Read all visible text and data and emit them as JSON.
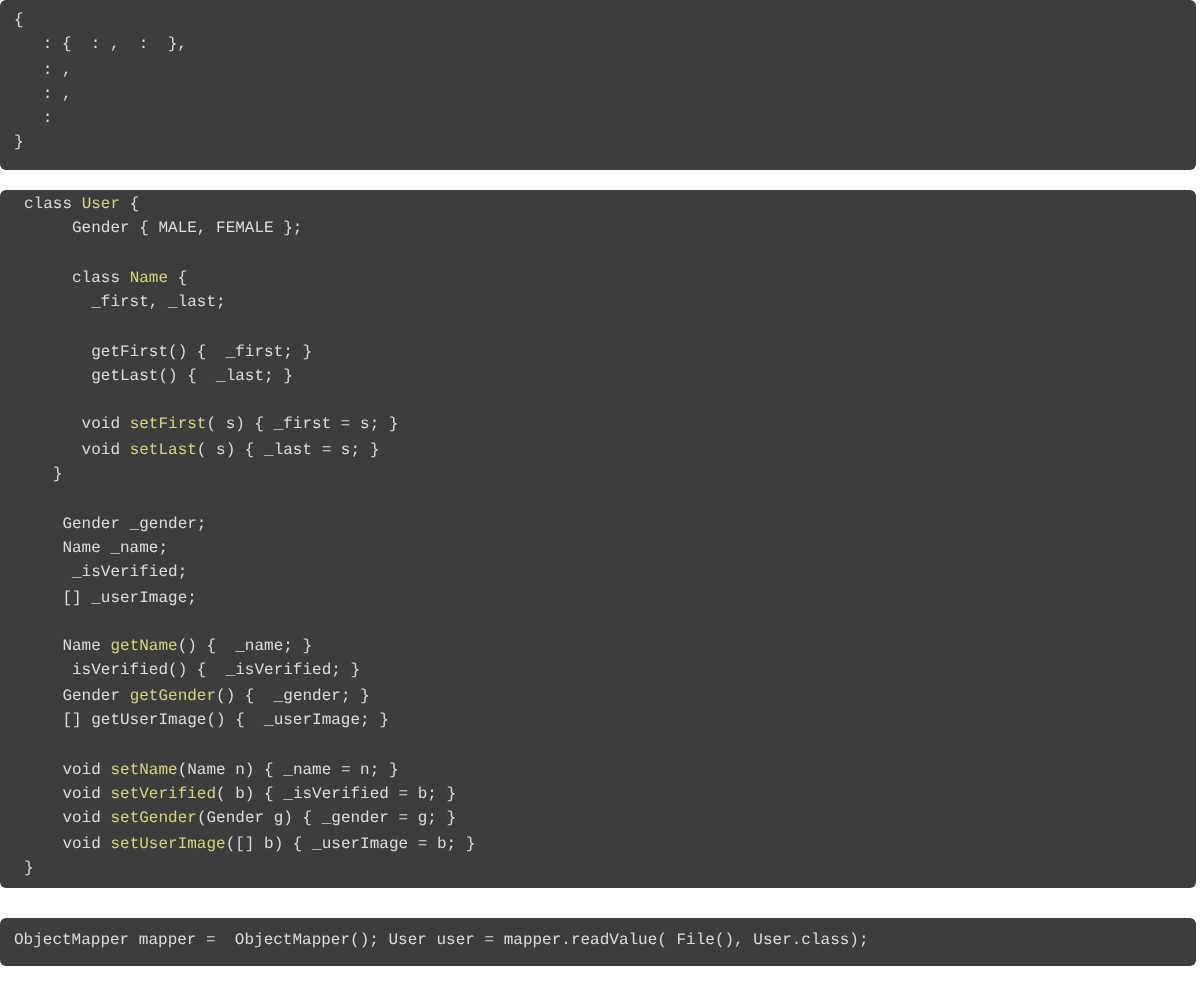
{
  "code_blocks": [
    {
      "lines": [
        {
          "kind": "code",
          "segments": [
            {
              "text": "{",
              "kind": "plain"
            }
          ]
        },
        {
          "kind": "code",
          "segments": [
            {
              "text": "   : {  : ,  :  },",
              "kind": "plain"
            }
          ]
        },
        {
          "kind": "code",
          "segments": [
            {
              "text": "   : ,",
              "kind": "plain"
            }
          ]
        },
        {
          "kind": "code",
          "segments": [
            {
              "text": "   : ,",
              "kind": "plain"
            }
          ]
        },
        {
          "kind": "code",
          "segments": [
            {
              "text": "   :",
              "kind": "plain"
            }
          ]
        },
        {
          "kind": "code",
          "segments": [
            {
              "text": "}",
              "kind": "plain"
            }
          ]
        }
      ]
    },
    {
      "lines": [
        {
          "kind": "code",
          "segments": [
            {
              "text": "class ",
              "kind": "plain"
            },
            {
              "text": "User",
              "kind": "name"
            },
            {
              "text": " {",
              "kind": "plain"
            }
          ]
        },
        {
          "kind": "code",
          "segments": [
            {
              "text": "     Gender { MALE, FEMALE };",
              "kind": "plain"
            }
          ]
        },
        {
          "kind": "blank"
        },
        {
          "kind": "code",
          "segments": [
            {
              "text": "     class ",
              "kind": "plain"
            },
            {
              "text": "Name",
              "kind": "name"
            },
            {
              "text": " {",
              "kind": "plain"
            }
          ]
        },
        {
          "kind": "code",
          "segments": [
            {
              "text": "       _first, _last;",
              "kind": "plain"
            }
          ]
        },
        {
          "kind": "blank"
        },
        {
          "kind": "code",
          "segments": [
            {
              "text": "       getFirst() {  _first; }",
              "kind": "plain"
            }
          ]
        },
        {
          "kind": "code",
          "segments": [
            {
              "text": "       getLast() {  _last; }",
              "kind": "plain"
            }
          ]
        },
        {
          "kind": "blank"
        },
        {
          "kind": "code",
          "segments": [
            {
              "text": "      void ",
              "kind": "plain"
            },
            {
              "text": "setFirst",
              "kind": "name"
            },
            {
              "text": "( s) { _first = s; }",
              "kind": "plain"
            }
          ]
        },
        {
          "kind": "code",
          "segments": [
            {
              "text": "      void ",
              "kind": "plain"
            },
            {
              "text": "setLast",
              "kind": "name"
            },
            {
              "text": "( s) { _last = s; }",
              "kind": "plain"
            }
          ]
        },
        {
          "kind": "code",
          "segments": [
            {
              "text": "   }",
              "kind": "plain"
            }
          ]
        },
        {
          "kind": "blank"
        },
        {
          "kind": "code",
          "segments": [
            {
              "text": "    Gender _gender;",
              "kind": "plain"
            }
          ]
        },
        {
          "kind": "code",
          "segments": [
            {
              "text": "    Name _name;",
              "kind": "plain"
            }
          ]
        },
        {
          "kind": "code",
          "segments": [
            {
              "text": "     _isVerified;",
              "kind": "plain"
            }
          ]
        },
        {
          "kind": "code",
          "segments": [
            {
              "text": "    [] _userImage;",
              "kind": "plain"
            }
          ]
        },
        {
          "kind": "blank"
        },
        {
          "kind": "code",
          "segments": [
            {
              "text": "    Name ",
              "kind": "plain"
            },
            {
              "text": "getName",
              "kind": "name"
            },
            {
              "text": "() {  _name; }",
              "kind": "plain"
            }
          ]
        },
        {
          "kind": "code",
          "segments": [
            {
              "text": "     isVerified() {  _isVerified; }",
              "kind": "plain"
            }
          ]
        },
        {
          "kind": "code",
          "segments": [
            {
              "text": "    Gender ",
              "kind": "plain"
            },
            {
              "text": "getGender",
              "kind": "name"
            },
            {
              "text": "() {  _gender; }",
              "kind": "plain"
            }
          ]
        },
        {
          "kind": "code",
          "segments": [
            {
              "text": "    [] getUserImage() {  _userImage; }",
              "kind": "plain"
            }
          ]
        },
        {
          "kind": "blank"
        },
        {
          "kind": "code",
          "segments": [
            {
              "text": "    void ",
              "kind": "plain"
            },
            {
              "text": "setName",
              "kind": "name"
            },
            {
              "text": "(Name n) { _name = n; }",
              "kind": "plain"
            }
          ]
        },
        {
          "kind": "code",
          "segments": [
            {
              "text": "    void ",
              "kind": "plain"
            },
            {
              "text": "setVerified",
              "kind": "name"
            },
            {
              "text": "( b) { _isVerified = b; }",
              "kind": "plain"
            }
          ]
        },
        {
          "kind": "code",
          "segments": [
            {
              "text": "    void ",
              "kind": "plain"
            },
            {
              "text": "setGender",
              "kind": "name"
            },
            {
              "text": "(Gender g) { _gender = g; }",
              "kind": "plain"
            }
          ]
        },
        {
          "kind": "code",
          "segments": [
            {
              "text": "    void ",
              "kind": "plain"
            },
            {
              "text": "setUserImage",
              "kind": "name"
            },
            {
              "text": "([] b) { _userImage = b; }",
              "kind": "plain"
            }
          ]
        },
        {
          "kind": "code",
          "segments": [
            {
              "text": "}",
              "kind": "plain"
            }
          ]
        }
      ]
    },
    {
      "lines": [
        {
          "kind": "code",
          "segments": [
            {
              "text": "ObjectMapper mapper =  ObjectMapper(); User user = mapper.readValue( File(), User.class);",
              "kind": "plain"
            }
          ]
        }
      ]
    }
  ]
}
